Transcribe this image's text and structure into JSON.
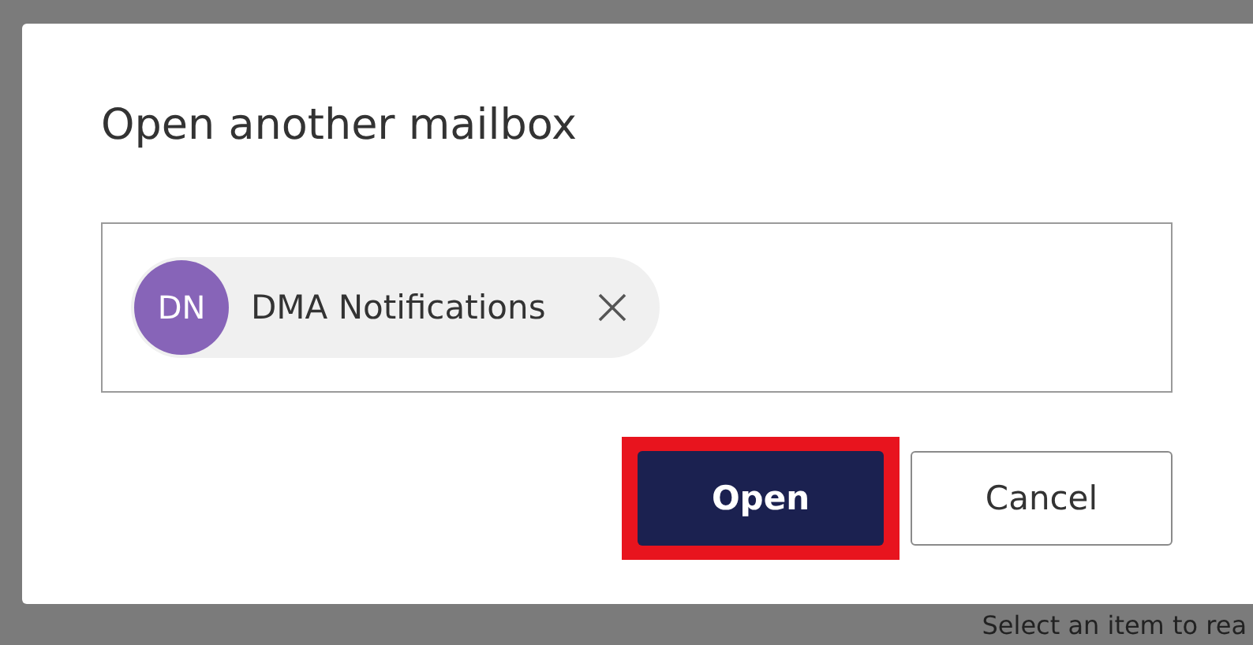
{
  "dialog": {
    "title": "Open another mailbox",
    "recipients": [
      {
        "initials": "DN",
        "name": "DMA Notifications",
        "color": "#8764b8"
      }
    ],
    "buttons": [
      {
        "label": "Open",
        "kind": "primary",
        "highlighted": true
      },
      {
        "label": "Cancel",
        "kind": "secondary",
        "highlighted": false
      }
    ]
  },
  "background_text": "Select an item to rea"
}
